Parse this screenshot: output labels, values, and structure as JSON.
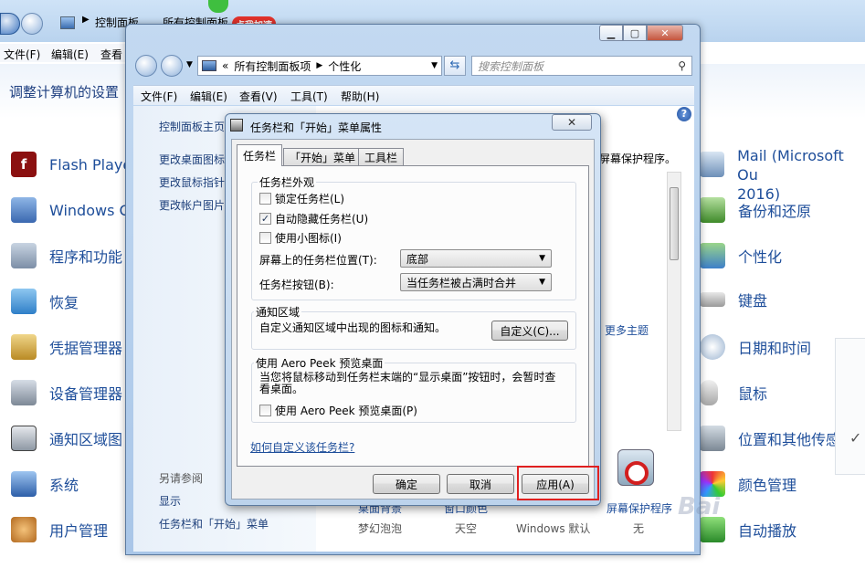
{
  "bg": {
    "breadcrumb": [
      "控制面板",
      "所有控制面板"
    ],
    "badge_label": "点我加速",
    "menu": [
      "文件(F)",
      "编辑(E)",
      "查看"
    ],
    "heading": "调整计算机的设置",
    "left_items": [
      {
        "label": "Flash Playe",
        "icon": "flash-icon"
      },
      {
        "label": "Windows C",
        "icon": "windows-cardspace-icon"
      },
      {
        "label": "程序和功能",
        "icon": "programs-icon"
      },
      {
        "label": "恢复",
        "icon": "recovery-icon"
      },
      {
        "label": "凭据管理器",
        "icon": "credential-icon"
      },
      {
        "label": "设备管理器",
        "icon": "device-manager-icon"
      },
      {
        "label": "通知区域图",
        "icon": "notification-area-icon"
      },
      {
        "label": "系统",
        "icon": "system-icon"
      },
      {
        "label": "用户管理",
        "icon": "user-icon"
      }
    ],
    "right_items": [
      {
        "label": "Mail (Microsoft Ou",
        "label2": "2016)",
        "icon": "mail-icon"
      },
      {
        "label": "备份和还原",
        "icon": "backup-icon"
      },
      {
        "label": "个性化",
        "icon": "personalization-icon"
      },
      {
        "label": "键盘",
        "icon": "keyboard-icon"
      },
      {
        "label": "日期和时间",
        "icon": "clock-icon"
      },
      {
        "label": "鼠标",
        "icon": "mouse-icon"
      },
      {
        "label": "位置和其他传感",
        "icon": "location-icon"
      },
      {
        "label": "颜色管理",
        "icon": "color-icon"
      },
      {
        "label": "自动播放",
        "icon": "autoplay-icon"
      }
    ],
    "check_glyph": "✓"
  },
  "win": {
    "address": [
      "所有控制面板项",
      "个性化"
    ],
    "address_prefix": "«",
    "search_placeholder": "搜索控制面板",
    "menu": [
      "文件(F)",
      "编辑(E)",
      "查看(V)",
      "工具(T)",
      "帮助(H)"
    ],
    "sidebar": {
      "links": [
        "控制面板主页",
        "更改桌面图标",
        "更改鼠标指针",
        "更改帐户图片"
      ],
      "see_also_title": "另请参阅",
      "see_also": [
        "显示",
        "任务栏和「开始」菜单"
      ]
    },
    "right_text": "屏幕保护程序。",
    "more_themes": "更多主题",
    "bottom_labels": [
      "桌面背景",
      "窗口颜色",
      "屏幕保护程序"
    ],
    "themes": [
      "梦幻泡泡",
      "天空",
      "Windows 默认",
      "无"
    ],
    "help_glyph": "?"
  },
  "dialog": {
    "title": "任务栏和「开始」菜单属性",
    "tabs": [
      "任务栏",
      "「开始」菜单",
      "工具栏"
    ],
    "appearance": {
      "title": "任务栏外观",
      "checkboxes": [
        {
          "label": "锁定任务栏(L)",
          "checked": false
        },
        {
          "label": "自动隐藏任务栏(U)",
          "checked": true
        },
        {
          "label": "使用小图标(I)",
          "checked": false
        }
      ],
      "position_label": "屏幕上的任务栏位置(T):",
      "position_value": "底部",
      "buttons_label": "任务栏按钮(B):",
      "buttons_value": "当任务栏被占满时合并"
    },
    "notify": {
      "title": "通知区域",
      "desc": "自定义通知区域中出现的图标和通知。",
      "customize": "自定义(C)..."
    },
    "peek": {
      "title": "使用 Aero Peek 预览桌面",
      "desc": "当您将鼠标移动到任务栏末端的“显示桌面”按钮时，会暂时查看桌面。",
      "checkbox": "使用 Aero Peek 预览桌面(P)",
      "checked": false
    },
    "help_link": "如何自定义该任务栏?",
    "ok": "确定",
    "cancel": "取消",
    "apply": "应用(A)",
    "checked_glyph": "✓"
  }
}
